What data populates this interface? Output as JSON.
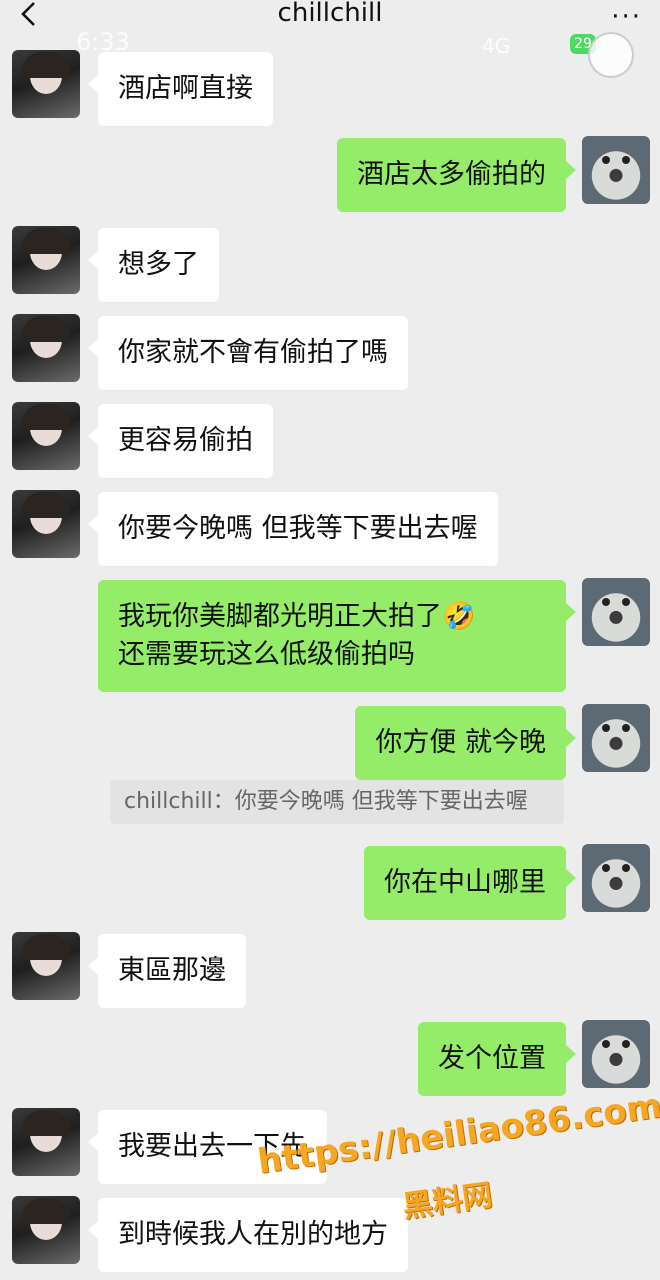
{
  "status": {
    "time": "6:33",
    "network": "4G",
    "battery": "29"
  },
  "header": {
    "title": "chillchill",
    "more": "···"
  },
  "messages": [
    {
      "side": "left",
      "text": "酒店啊直接"
    },
    {
      "side": "right",
      "text": "酒店太多偷拍的"
    },
    {
      "side": "left",
      "text": "想多了"
    },
    {
      "side": "left",
      "text": "你家就不會有偷拍了嗎"
    },
    {
      "side": "left",
      "text": "更容易偷拍"
    },
    {
      "side": "left",
      "text": "你要今晚嗎 但我等下要出去喔"
    },
    {
      "side": "right",
      "text": "我玩你美脚都光明正大拍了🤣\n还需要玩这么低级偷拍吗"
    },
    {
      "side": "right",
      "text": "你方便 就今晚"
    },
    {
      "side": "right",
      "text": "你在中山哪里"
    },
    {
      "side": "left",
      "text": "東區那邊"
    },
    {
      "side": "right",
      "text": "发个位置"
    },
    {
      "side": "left",
      "text": "我要出去一下先"
    },
    {
      "side": "left",
      "text": "到時候我人在別的地方"
    }
  ],
  "quote": {
    "text": "chillchill：你要今晚嗎 但我等下要出去喔"
  },
  "watermark": {
    "line1": "https://heiliao86.com",
    "line2": "黑料网"
  },
  "colors": {
    "self_bubble": "#95ec69",
    "other_bubble": "#ffffff",
    "background": "#ededed"
  }
}
